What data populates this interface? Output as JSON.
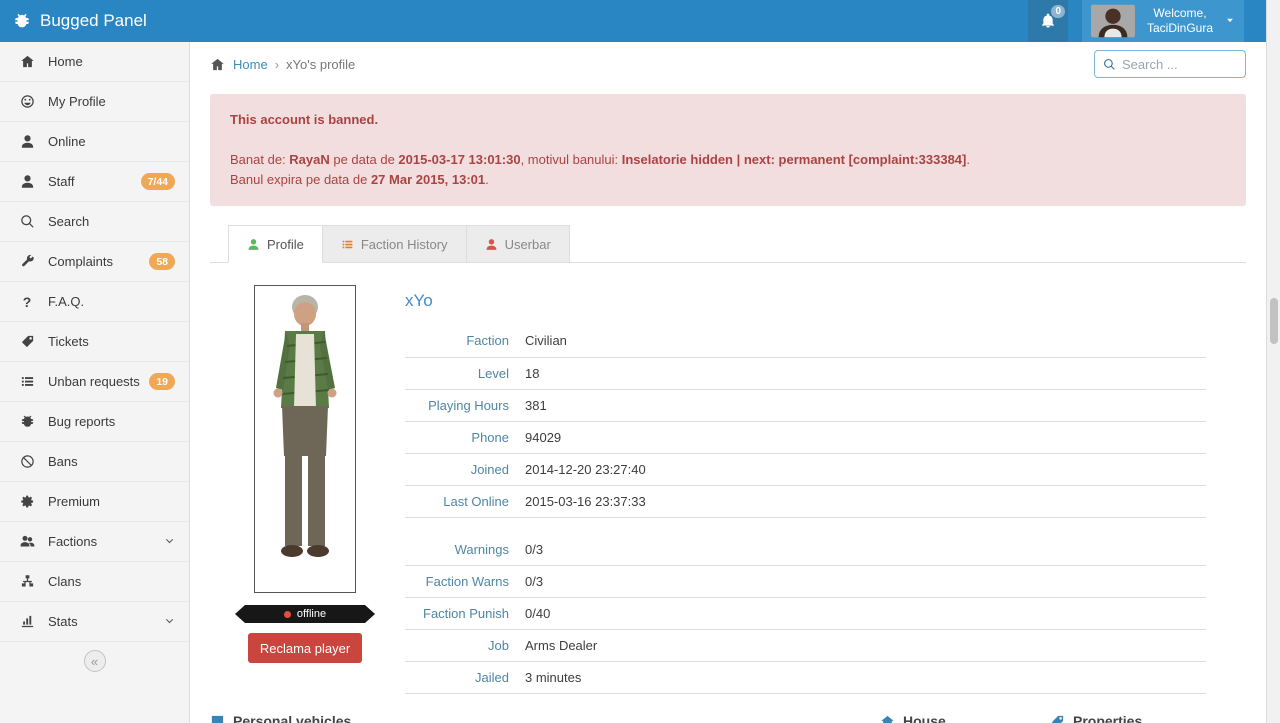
{
  "header": {
    "app_title": "Bugged Panel",
    "notification_badge": "0",
    "welcome_label": "Welcome,",
    "username": "TaciDinGura"
  },
  "sidebar": {
    "items": [
      {
        "label": "Home"
      },
      {
        "label": "My Profile"
      },
      {
        "label": "Online"
      },
      {
        "label": "Staff",
        "badge": "7/44"
      },
      {
        "label": "Search"
      },
      {
        "label": "Complaints",
        "badge": "58"
      },
      {
        "label": "F.A.Q."
      },
      {
        "label": "Tickets"
      },
      {
        "label": "Unban requests",
        "badge": "19"
      },
      {
        "label": "Bug reports"
      },
      {
        "label": "Bans"
      },
      {
        "label": "Premium"
      },
      {
        "label": "Factions"
      },
      {
        "label": "Clans"
      },
      {
        "label": "Stats"
      }
    ],
    "collapse_glyph": "«",
    "question_glyph": "?"
  },
  "breadcrumb": {
    "home_label": "Home",
    "separator": "›",
    "current": "xYo's profile"
  },
  "search": {
    "placeholder": "Search ..."
  },
  "ban_alert": {
    "title": "This account is banned.",
    "line1": {
      "t1": "Banat de: ",
      "b1": "RayaN",
      "t2": " pe data de ",
      "b2": "2015-03-17 13:01:30",
      "t3": ", motivul banului: ",
      "b3": "Inselatorie hidden | next: permanent [complaint:333384]",
      "t4": "."
    },
    "line2": {
      "t1": "Banul expira pe data de ",
      "b1": "27 Mar 2015, 13:01",
      "t2": "."
    }
  },
  "tabs": [
    {
      "label": "Profile"
    },
    {
      "label": "Faction History"
    },
    {
      "label": "Userbar"
    }
  ],
  "profile": {
    "name": "xYo",
    "status": "offline",
    "report_button": "Reclama player",
    "fields_main": [
      {
        "label": "Faction",
        "value": "Civilian"
      },
      {
        "label": "Level",
        "value": "18"
      },
      {
        "label": "Playing Hours",
        "value": "381"
      },
      {
        "label": "Phone",
        "value": "94029"
      },
      {
        "label": "Joined",
        "value": "2014-12-20 23:27:40"
      },
      {
        "label": "Last Online",
        "value": "2015-03-16 23:37:33"
      }
    ],
    "fields_secondary": [
      {
        "label": "Warnings",
        "value": "0/3"
      },
      {
        "label": "Faction Warns",
        "value": "0/3"
      },
      {
        "label": "Faction Punish",
        "value": "0/40"
      },
      {
        "label": "Job",
        "value": "Arms Dealer"
      },
      {
        "label": "Jailed",
        "value": "3 minutes"
      }
    ]
  },
  "bottom_sections": [
    {
      "label": "Personal vehicles"
    },
    {
      "label": "House"
    },
    {
      "label": "Properties"
    }
  ],
  "colors": {
    "header_blue": "#2a86c2",
    "alert_bg": "#f2dede",
    "alert_text": "#a94442",
    "badge_orange": "#efa855",
    "link_blue": "#3d8eb9",
    "button_red": "#c9453d",
    "active_tab_icon_green": "#5cb85c",
    "offline_dot_red": "#e74c3c"
  }
}
